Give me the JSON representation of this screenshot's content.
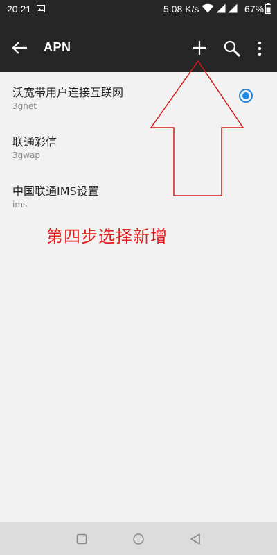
{
  "status_bar": {
    "time": "20:21",
    "network_speed": "5.08 K/s",
    "battery": "67%",
    "icons": [
      "photo-icon",
      "wifi-icon",
      "signal-icon",
      "signal-icon",
      "battery-icon"
    ]
  },
  "app_bar": {
    "title": "APN",
    "icons": [
      "back-arrow-icon",
      "plus-icon",
      "search-icon",
      "more-vert-icon"
    ]
  },
  "apn_list": [
    {
      "name": "沃宽带用户连接互联网",
      "type": "3gnet",
      "selected": true
    },
    {
      "name": "联通彩信",
      "type": "3gwap",
      "selected": false
    },
    {
      "name": "中国联通IMS设置",
      "type": "ims",
      "selected": false
    }
  ],
  "annotation": {
    "text": "第四步选择新增",
    "color": "#e21e1e"
  },
  "colors": {
    "app_bar": "#262626",
    "background": "#f2f2f2",
    "accent": "#1e88e5",
    "nav_bar": "#dcdcdc"
  },
  "nav_bar": {
    "icons": [
      "square-recents-icon",
      "circle-home-icon",
      "triangle-back-icon"
    ]
  }
}
